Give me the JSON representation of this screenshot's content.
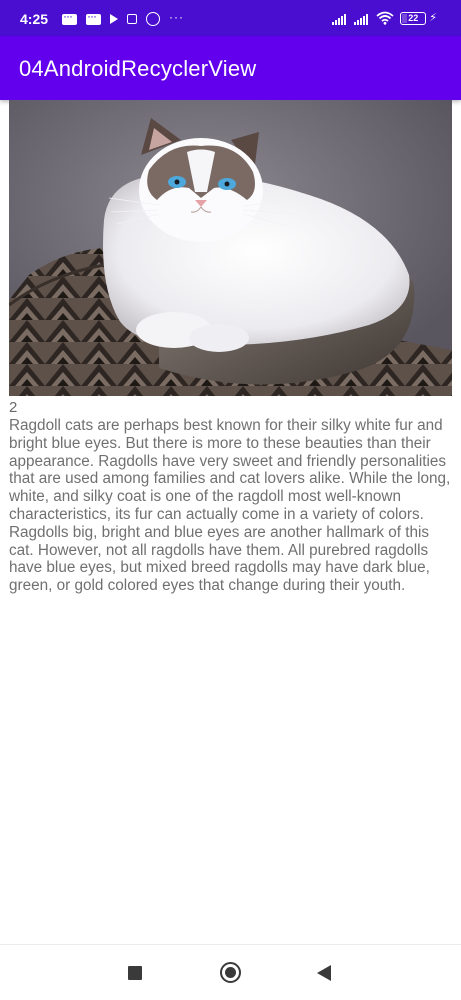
{
  "status_bar": {
    "time": "4:25",
    "notification_icons": [
      "message-icon",
      "message-icon",
      "play-icon",
      "play-box-icon",
      "whatsapp-icon",
      "more-dots-icon"
    ],
    "more_dots": "···",
    "battery_level": "22",
    "charging_icon": "⚡"
  },
  "app_bar": {
    "title": "04AndroidRecyclerView",
    "color": "#6200ee"
  },
  "list": {
    "items": [
      {
        "image_icon": "ragdoll-cat-image",
        "number": "2",
        "description": " Ragdoll cats are perhaps best known for their silky white fur and bright blue eyes. But there is more to these beauties than their appearance. Ragdolls have very sweet and friendly personalities that are used among families and cat lovers alike. While the long, white, and silky coat is one of the ragdoll most well-known characteristics, its fur can actually come in a variety of colors. Ragdolls big, bright and blue eyes are another hallmark of this cat. However, not all ragdolls have them. All purebred ragdolls have blue eyes, but mixed breed ragdolls may have dark blue, green, or gold colored eyes that change during their youth."
      }
    ]
  },
  "nav_bar": {
    "recents_icon": "square-icon",
    "home_icon": "circle-icon",
    "back_icon": "triangle-back-icon"
  }
}
